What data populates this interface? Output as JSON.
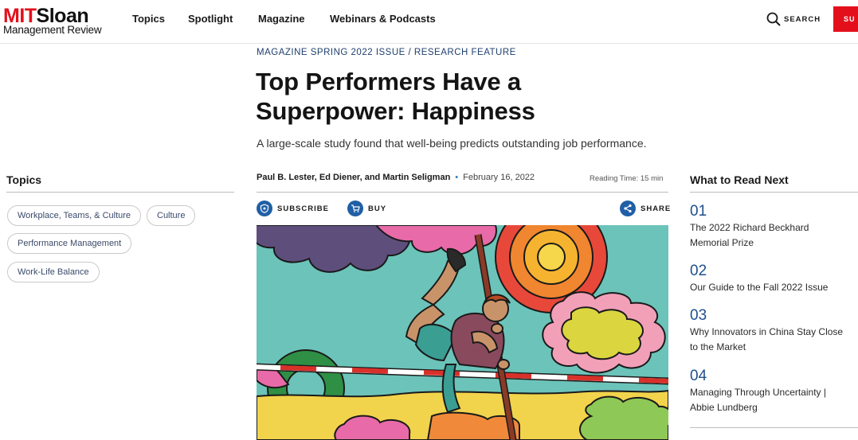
{
  "header": {
    "logo_mit": "MIT",
    "logo_sloan": "Sloan",
    "logo_sub": "Management Review",
    "nav": [
      "Topics",
      "Spotlight",
      "Magazine",
      "Webinars & Podcasts"
    ],
    "search_label": "SEARCH",
    "subscribe_cta": "SU"
  },
  "article": {
    "kicker": "MAGAZINE SPRING 2022 ISSUE / RESEARCH FEATURE",
    "title": "Top Performers Have a Superpower: Happiness",
    "dek": "A large-scale study found that well-being predicts outstanding job performance.",
    "authors": "Paul B. Lester, Ed Diener, and Martin Seligman",
    "date": "February 16, 2022",
    "reading_time": "Reading Time: 15 min",
    "actions": {
      "subscribe": "SUBSCRIBE",
      "buy": "BUY",
      "share": "SHARE"
    }
  },
  "topics": {
    "heading": "Topics",
    "tags": [
      "Workplace, Teams, & Culture",
      "Culture",
      "Performance Management",
      "Work-Life Balance"
    ]
  },
  "read_next": {
    "heading": "What to Read Next",
    "items": [
      {
        "num": "01",
        "title": "The 2022 Richard Beckhard Memorial Prize"
      },
      {
        "num": "02",
        "title": "Our Guide to the Fall 2022 Issue"
      },
      {
        "num": "03",
        "title": "Why Innovators in China Stay Close to the Market"
      },
      {
        "num": "04",
        "title": "Managing Through Uncertainty | Abbie Lundberg"
      }
    ]
  },
  "colors": {
    "brand_red": "#e3101c",
    "link_blue": "#1e4f8c",
    "icon_blue": "#1f5fa6"
  }
}
